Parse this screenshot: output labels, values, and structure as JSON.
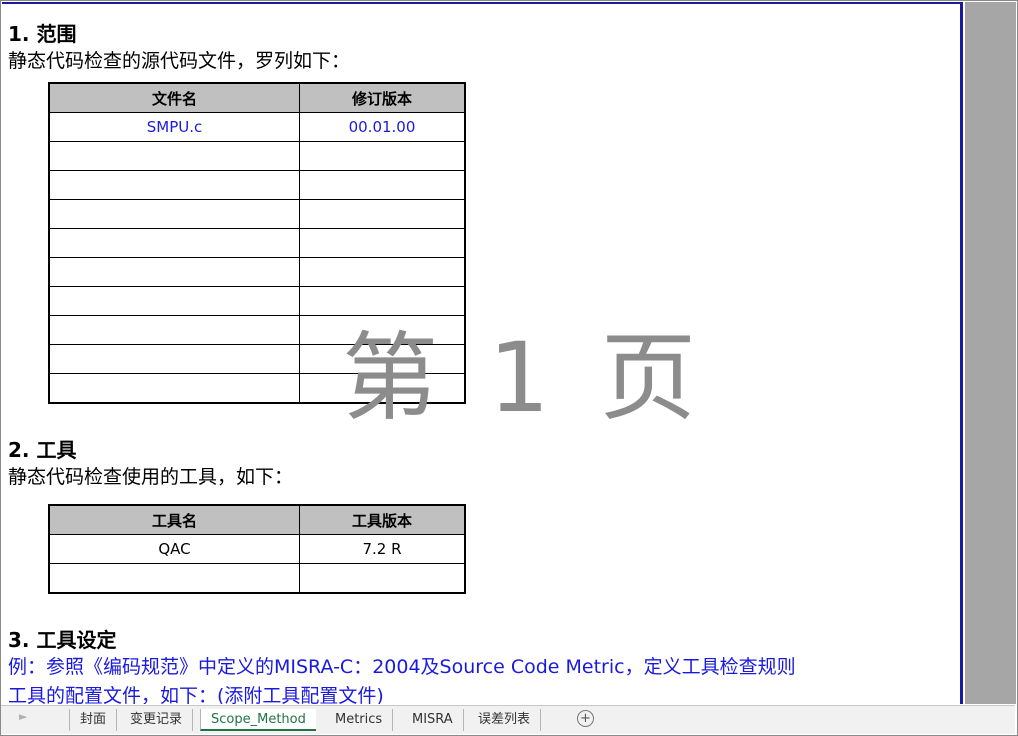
{
  "sections": {
    "scope_title": "1. 范围",
    "scope_desc": "静态代码检查的源代码文件，罗列如下：",
    "tools_title": "2. 工具",
    "tools_desc": "静态代码检查使用的工具，如下：",
    "settings_title": "3. 工具设定",
    "settings_line1": "例：参照《编码规范》中定义的MISRA-C：2004及Source Code Metric，定义工具检查规则",
    "settings_line2": "工具的配置文件，如下：(添附工具配置文件)"
  },
  "files_table": {
    "headers": [
      "文件名",
      "修订版本"
    ],
    "rows": [
      [
        "SMPU.c",
        "00.01.00"
      ],
      [
        "",
        ""
      ],
      [
        "",
        ""
      ],
      [
        "",
        ""
      ],
      [
        "",
        ""
      ],
      [
        "",
        ""
      ],
      [
        "",
        ""
      ],
      [
        "",
        ""
      ],
      [
        "",
        ""
      ],
      [
        "",
        ""
      ]
    ]
  },
  "tools_table": {
    "headers": [
      "工具名",
      "工具版本"
    ],
    "rows": [
      [
        "QAC",
        "7.2 R"
      ],
      [
        "",
        ""
      ]
    ]
  },
  "watermark": "第 1 页",
  "sheet_tabs": [
    "封面",
    "变更记录",
    "Scope_Method",
    "Metrics",
    "MISRA",
    "误差列表"
  ],
  "active_tab": "Scope_Method",
  "colors": {
    "accent_blue": "#1a1adf",
    "header_gray": "#c0c0c0",
    "tab_active": "#217346"
  }
}
